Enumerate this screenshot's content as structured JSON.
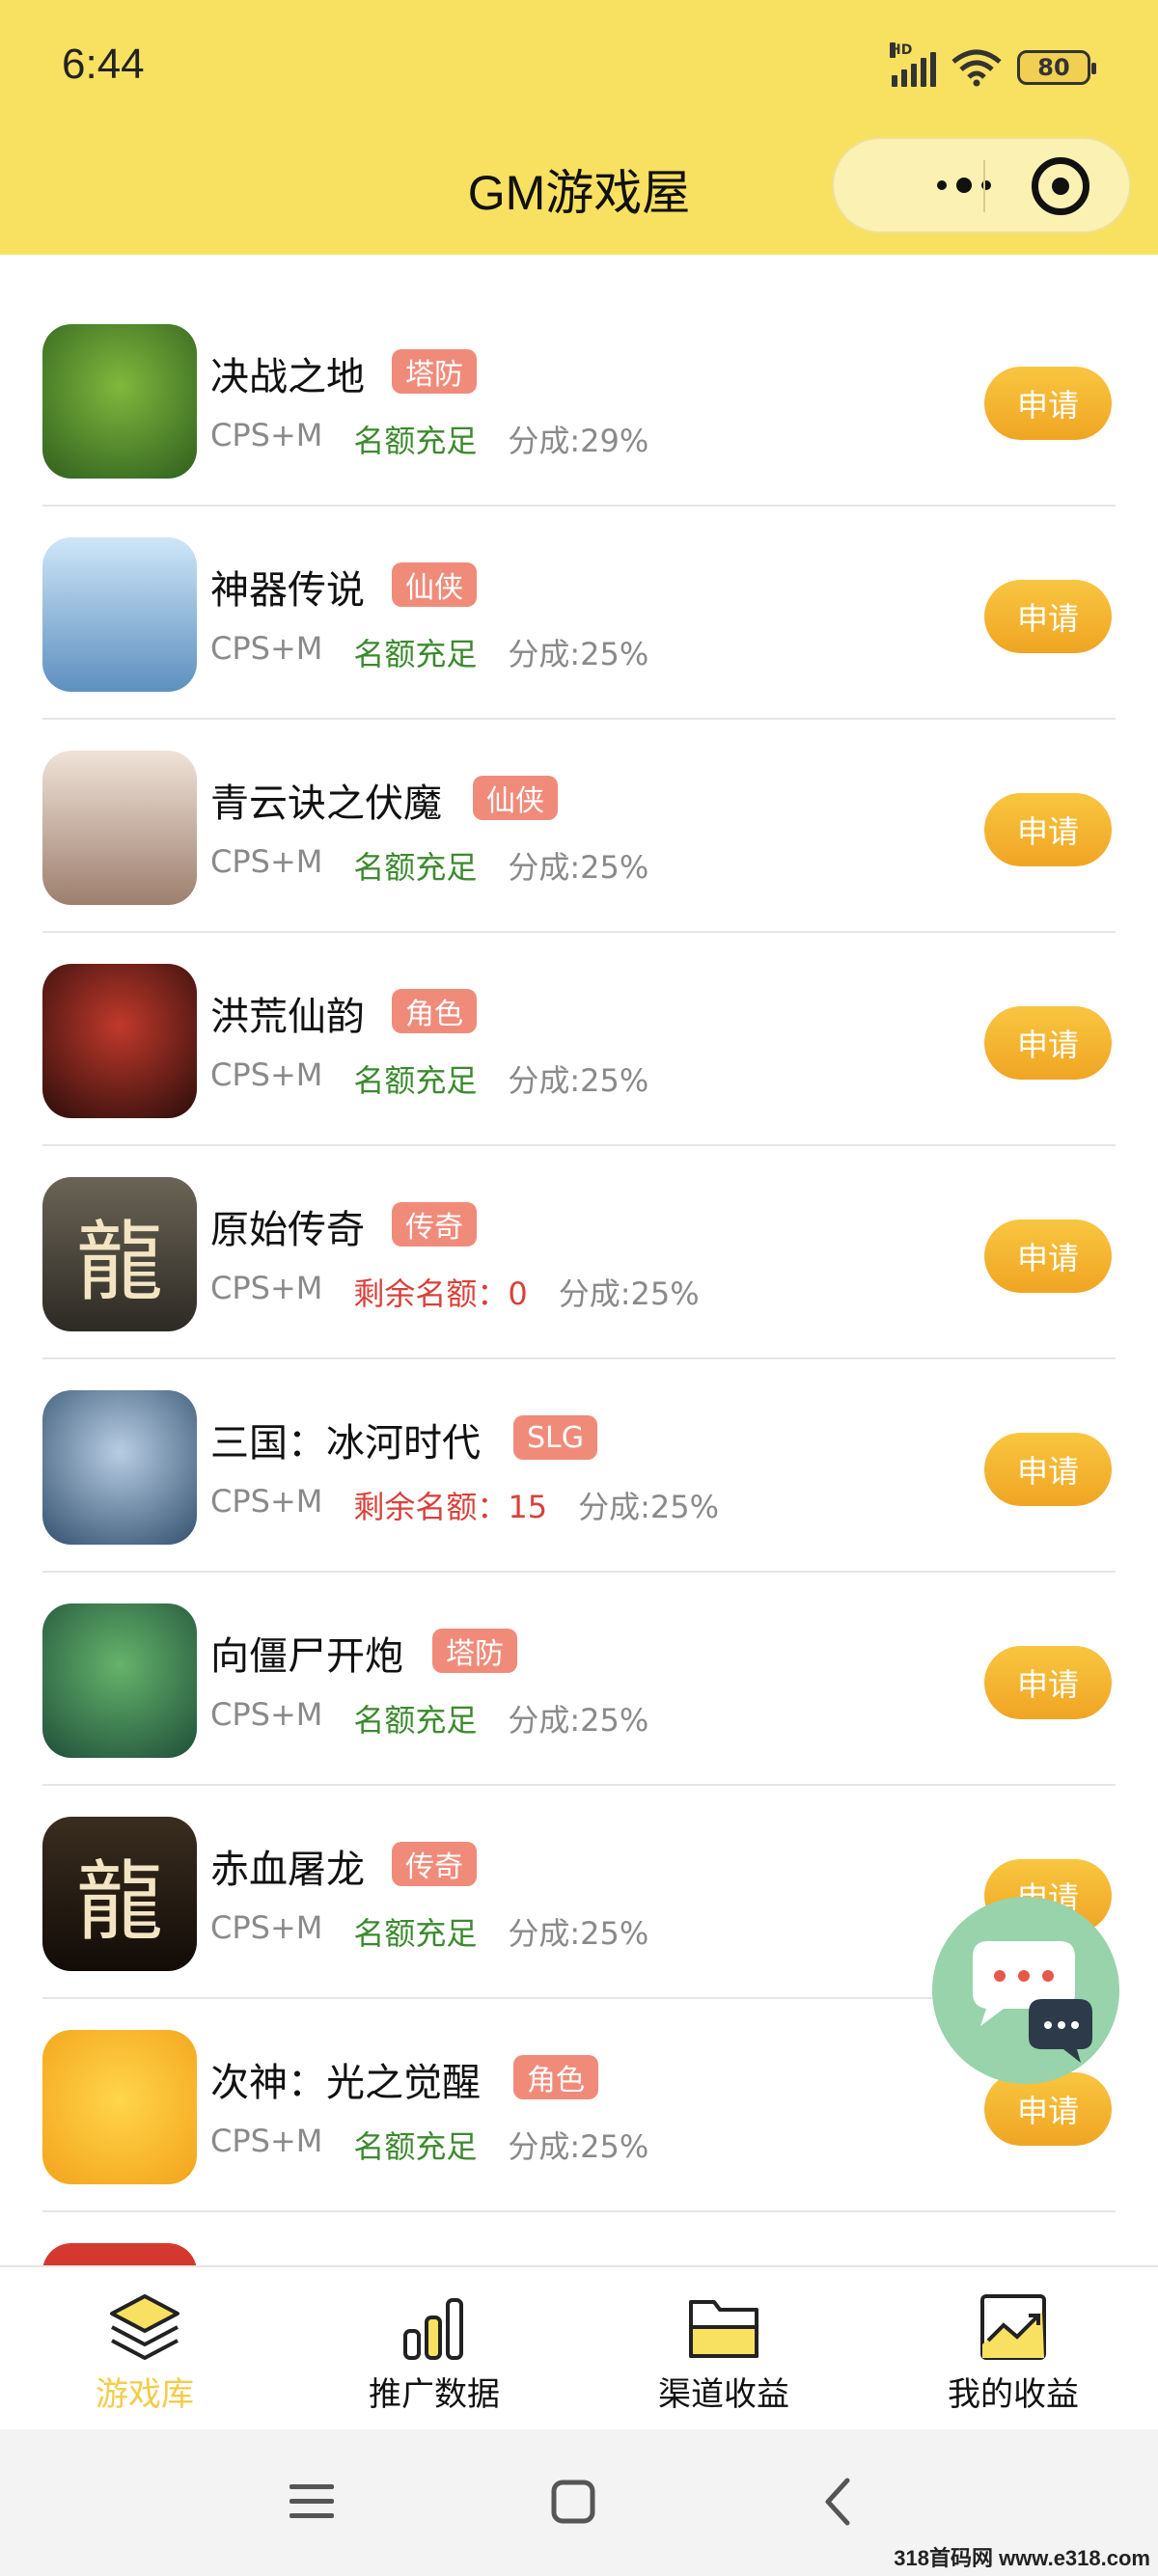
{
  "status": {
    "time": "6:44",
    "battery": "80",
    "network": "HD"
  },
  "header": {
    "title": "GM游戏屋"
  },
  "colors": {
    "header_bg": "#f8e061",
    "tag": "#f08b7a",
    "ok": "#3b8a2d",
    "low": "#d8413a",
    "button": "#f0a524",
    "tab_active": "#f3cc48"
  },
  "games": [
    {
      "name": "决战之地",
      "tag": "塔防",
      "model": "CPS+M",
      "quota": "名额充足",
      "quota_status": "ok",
      "share": "分成:29%",
      "apply": "申请"
    },
    {
      "name": "神器传说",
      "tag": "仙侠",
      "model": "CPS+M",
      "quota": "名额充足",
      "quota_status": "ok",
      "share": "分成:25%",
      "apply": "申请"
    },
    {
      "name": "青云诀之伏魔",
      "tag": "仙侠",
      "model": "CPS+M",
      "quota": "名额充足",
      "quota_status": "ok",
      "share": "分成:25%",
      "apply": "申请"
    },
    {
      "name": "洪荒仙韵",
      "tag": "角色",
      "model": "CPS+M",
      "quota": "名额充足",
      "quota_status": "ok",
      "share": "分成:25%",
      "apply": "申请"
    },
    {
      "name": "原始传奇",
      "tag": "传奇",
      "model": "CPS+M",
      "quota": "剩余名额：0",
      "quota_status": "low",
      "share": "分成:25%",
      "apply": "申请"
    },
    {
      "name": "三国：冰河时代",
      "tag": "SLG",
      "model": "CPS+M",
      "quota": "剩余名额：15",
      "quota_status": "low",
      "share": "分成:25%",
      "apply": "申请"
    },
    {
      "name": "向僵尸开炮",
      "tag": "塔防",
      "model": "CPS+M",
      "quota": "名额充足",
      "quota_status": "ok",
      "share": "分成:25%",
      "apply": "申请"
    },
    {
      "name": "赤血屠龙",
      "tag": "传奇",
      "model": "CPS+M",
      "quota": "名额充足",
      "quota_status": "ok",
      "share": "分成:25%",
      "apply": "申请"
    },
    {
      "name": "次神：光之觉醒",
      "tag": "角色",
      "model": "CPS+M",
      "quota": "名额充足",
      "quota_status": "ok",
      "share": "分成:25%",
      "apply": "申请"
    }
  ],
  "tabs": [
    {
      "label": "游戏库",
      "icon": "layers-icon",
      "active": true
    },
    {
      "label": "推广数据",
      "icon": "bar-chart-icon",
      "active": false
    },
    {
      "label": "渠道收益",
      "icon": "folder-icon",
      "active": false
    },
    {
      "label": "我的收益",
      "icon": "trend-chart-icon",
      "active": false
    }
  ],
  "watermark": "318首码网 www.e318.com"
}
